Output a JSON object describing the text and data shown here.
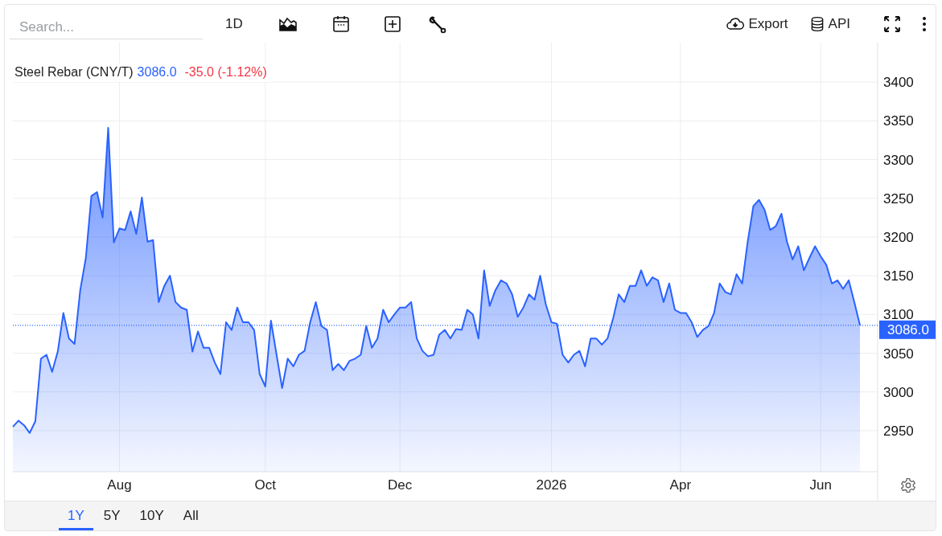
{
  "toolbar": {
    "search": {
      "placeholder": "Search..."
    },
    "interval": "1D",
    "export": "Export",
    "api": "API"
  },
  "legend": {
    "price": "3086.0",
    "change": "-35.0 (-1.12%)"
  },
  "chart_data": {
    "type": "area",
    "grid": true,
    "ylim": [
      2897,
      3451
    ],
    "ref_lines": [
      {
        "axis": "y",
        "value": 3086,
        "label": "3086.0",
        "color": "#2962ff"
      }
    ],
    "categories": [
      null,
      null,
      null,
      null,
      null,
      null,
      null,
      null,
      null,
      null,
      null,
      null,
      null,
      null,
      null,
      null,
      null,
      null,
      null,
      "Aug",
      null,
      null,
      null,
      null,
      null,
      null,
      null,
      null,
      null,
      null,
      null,
      null,
      null,
      null,
      null,
      null,
      null,
      null,
      null,
      null,
      null,
      null,
      null,
      null,
      null,
      "Oct",
      null,
      null,
      null,
      null,
      null,
      null,
      null,
      null,
      null,
      null,
      null,
      null,
      null,
      null,
      null,
      null,
      null,
      null,
      null,
      null,
      null,
      null,
      null,
      "Dec",
      null,
      null,
      null,
      null,
      null,
      null,
      null,
      null,
      null,
      null,
      null,
      null,
      null,
      null,
      null,
      null,
      null,
      null,
      null,
      null,
      null,
      null,
      null,
      null,
      null,
      null,
      "2026",
      null,
      null,
      null,
      null,
      null,
      null,
      null,
      null,
      null,
      null,
      null,
      null,
      null,
      null,
      null,
      null,
      null,
      null,
      null,
      null,
      null,
      null,
      "Apr",
      null,
      null,
      null,
      null,
      null,
      null,
      null,
      null,
      null,
      null,
      null,
      null,
      null,
      null,
      null,
      null,
      null,
      null,
      null,
      null,
      null,
      null,
      null,
      null,
      "Jun",
      null,
      null,
      null,
      null,
      null,
      null,
      null
    ],
    "yticks": [
      2950,
      3000,
      3050,
      3100,
      3150,
      3200,
      3250,
      3300,
      3350,
      3400
    ],
    "series": [
      {
        "name": "Steel Rebar (CNY/T)",
        "color": "#2962ff",
        "values": [
          2955,
          2963,
          2957,
          2947,
          2962,
          3043,
          3048,
          3026,
          3052,
          3102,
          3069,
          3062,
          3131,
          3173,
          3253,
          3258,
          3225,
          3341,
          3193,
          3211,
          3209,
          3233,
          3204,
          3251,
          3194,
          3196,
          3116,
          3137,
          3150,
          3116,
          3109,
          3106,
          3052,
          3078,
          3057,
          3057,
          3038,
          3023,
          3090,
          3080,
          3109,
          3090,
          3090,
          3080,
          3023,
          3007,
          3092,
          3048,
          3005,
          3043,
          3033,
          3048,
          3053,
          3090,
          3116,
          3085,
          3080,
          3028,
          3036,
          3028,
          3040,
          3043,
          3048,
          3085,
          3057,
          3069,
          3106,
          3090,
          3100,
          3109,
          3109,
          3116,
          3069,
          3053,
          3046,
          3048,
          3074,
          3080,
          3069,
          3081,
          3080,
          3106,
          3100,
          3069,
          3157,
          3111,
          3131,
          3144,
          3140,
          3126,
          3097,
          3109,
          3126,
          3119,
          3150,
          3113,
          3090,
          3088,
          3048,
          3038,
          3048,
          3053,
          3033,
          3069,
          3069,
          3061,
          3069,
          3095,
          3126,
          3116,
          3137,
          3137,
          3157,
          3137,
          3148,
          3144,
          3116,
          3140,
          3106,
          3102,
          3102,
          3090,
          3071,
          3080,
          3085,
          3102,
          3140,
          3129,
          3126,
          3152,
          3140,
          3194,
          3240,
          3248,
          3235,
          3209,
          3214,
          3230,
          3194,
          3171,
          3188,
          3157,
          3173,
          3188,
          3175,
          3164,
          3140,
          3144,
          3133,
          3144,
          3116,
          3086
        ]
      }
    ]
  },
  "ranges": [
    {
      "label": "1Y",
      "selected": true
    },
    {
      "label": "5Y",
      "selected": false
    },
    {
      "label": "10Y",
      "selected": false
    },
    {
      "label": "All",
      "selected": false
    }
  ]
}
